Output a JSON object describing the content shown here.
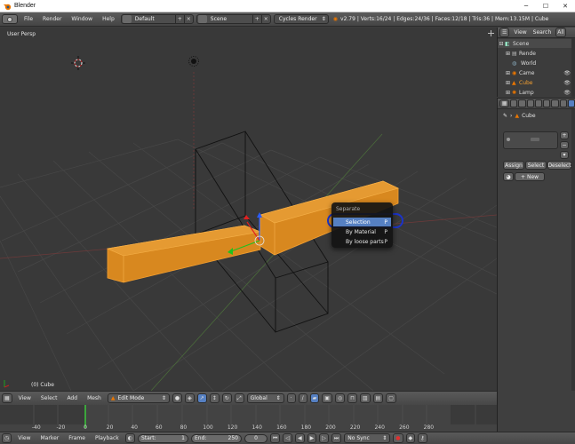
{
  "window": {
    "title": "Blender",
    "minimize": "─",
    "maximize": "☐",
    "close": "✕"
  },
  "infobar": {
    "menus": [
      "File",
      "Render",
      "Window",
      "Help"
    ],
    "layout": "Default",
    "scene": "Scene",
    "engine": "Cycles Render",
    "stats": "v2.79 | Verts:16/24 | Edges:24/36 | Faces:12/18 | Tris:36 | Mem:13.15M | Cube"
  },
  "viewport": {
    "view_label": "User Persp",
    "object_label": "(0) Cube"
  },
  "context_menu": {
    "title": "Separate",
    "items": [
      {
        "label": "Selection",
        "key": "P"
      },
      {
        "label": "By Material",
        "key": "P"
      },
      {
        "label": "By loose parts",
        "key": "P"
      }
    ]
  },
  "viewport_header": {
    "menus": [
      "View",
      "Select",
      "Add",
      "Mesh"
    ],
    "mode": "Edit Mode",
    "orientation": "Global"
  },
  "timeline": {
    "ticks": [
      "-40",
      "-20",
      "0",
      "20",
      "40",
      "60",
      "80",
      "100",
      "120",
      "140",
      "160",
      "180",
      "200",
      "220",
      "240",
      "260",
      "280"
    ],
    "menus": [
      "View",
      "Marker",
      "Frame",
      "Playback"
    ],
    "start_label": "Start:",
    "start_value": "1",
    "end_label": "End:",
    "end_value": "250",
    "current_frame": "0",
    "sync": "No Sync"
  },
  "outliner": {
    "tabs": [
      "View",
      "Search",
      "All"
    ],
    "rows": [
      "Scene",
      "Rende",
      "World",
      "Came",
      "Cube",
      "Lamp"
    ]
  },
  "properties": {
    "breadcrumb": "Cube",
    "slot_placeholder": "",
    "assign": "Assign",
    "select": "Select",
    "deselect": "Deselect",
    "new": "New"
  }
}
